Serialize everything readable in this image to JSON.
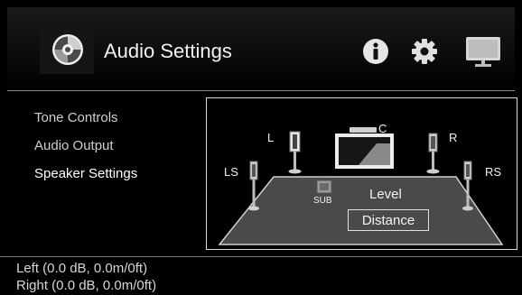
{
  "header": {
    "title": "Audio Settings",
    "icons": [
      "audio-disc-icon",
      "info-icon",
      "gear-icon",
      "display-icon"
    ]
  },
  "menu": {
    "items": [
      {
        "label": "Tone Controls",
        "active": false
      },
      {
        "label": "Audio Output",
        "active": false
      },
      {
        "label": "Speaker Settings",
        "active": true
      }
    ]
  },
  "speakers": {
    "left": "L",
    "center": "C",
    "right": "R",
    "left_surround": "LS",
    "right_surround": "RS",
    "subwoofer": "SUB"
  },
  "options": {
    "level": "Level",
    "distance": "Distance"
  },
  "status": {
    "line1": "Left (0.0 dB, 0.0m/0ft)",
    "line2": "Right (0.0 dB, 0.0m/0ft)"
  },
  "colors": {
    "background": "#000000",
    "floor": "#4a4a4a",
    "accent_border": "#d8d8d8"
  }
}
